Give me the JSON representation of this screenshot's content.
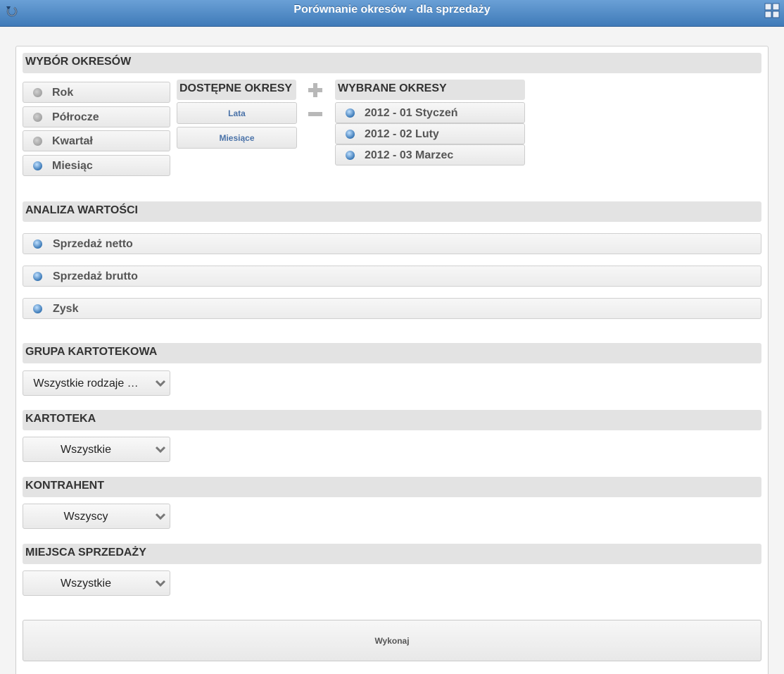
{
  "header": {
    "title": "Porównanie okresów - dla sprzedaży"
  },
  "periods": {
    "heading": "WYBÓR OKRESÓW",
    "types": [
      {
        "label": "Rok",
        "selected": false
      },
      {
        "label": "Półrocze",
        "selected": false
      },
      {
        "label": "Kwartał",
        "selected": false
      },
      {
        "label": "Miesiąc",
        "selected": true
      }
    ],
    "available_heading": "DOSTĘPNE OKRESY",
    "available": [
      "Lata",
      "Miesiące"
    ],
    "selected_heading": "WYBRANE OKRESY",
    "selected": [
      "2012 - 01 Styczeń",
      "2012 - 02 Luty",
      "2012 - 03 Marzec"
    ]
  },
  "analysis": {
    "heading": "ANALIZA WARTOŚCI",
    "items": [
      "Sprzedaż netto",
      "Sprzedaż brutto",
      "Zysk"
    ]
  },
  "group": {
    "heading": "GRUPA KARTOTEKOWA",
    "value": "Wszystkie rodzaje …"
  },
  "card": {
    "heading": "KARTOTEKA",
    "value": "Wszystkie"
  },
  "contractor": {
    "heading": "KONTRAHENT",
    "value": "Wszyscy"
  },
  "places": {
    "heading": "MIEJSCA SPRZEDAŻY",
    "value": "Wszystkie"
  },
  "execute_label": "Wykonaj",
  "colors": {
    "header_top": "#6aa0d6",
    "header_bottom": "#3f7ab8",
    "radio_active": "#3a78b6"
  }
}
